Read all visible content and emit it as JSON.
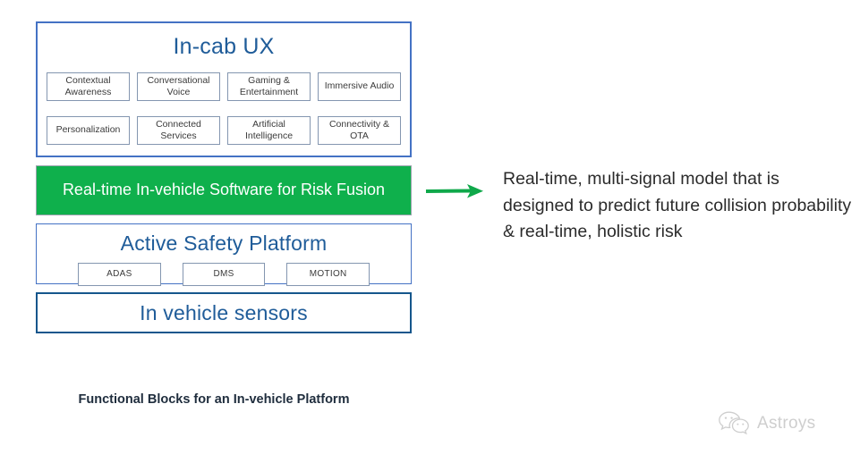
{
  "diagram": {
    "caption": "Functional Blocks for an In-vehicle Platform",
    "layers": [
      {
        "id": "in-cab-ux",
        "title": "In-cab UX",
        "border_color": "#4472c4",
        "rows": [
          [
            "Contextual Awareness",
            "Conversational Voice",
            "Gaming & Entertainment",
            "Immersive Audio"
          ],
          [
            "Personalization",
            "Connected Services",
            "Artificial Intelligence",
            "Connectivity & OTA"
          ]
        ]
      },
      {
        "id": "risk-fusion",
        "title": "Real-time In-vehicle Software for Risk Fusion",
        "fill_color": "#0fb04c",
        "text_color": "#ffffff"
      },
      {
        "id": "active-safety-platform",
        "title": "Active Safety Platform",
        "border_color": "#4472c4",
        "rows": [
          [
            "ADAS",
            "DMS",
            "MOTION"
          ]
        ]
      },
      {
        "id": "in-vehicle-sensors",
        "title": "In vehicle sensors",
        "border_color": "#15568c"
      }
    ]
  },
  "arrow": {
    "icon": "arrow-right-icon",
    "color": "#0fa84a",
    "direction": "right"
  },
  "description": {
    "text": "Real-time, multi-signal model that is designed to predict future collision probability & real-time, holistic risk"
  },
  "watermark": {
    "icon": "wechat-logo-icon",
    "label": "Astroys",
    "color": "#8c8c8c"
  },
  "colors": {
    "accent_blue": "#4472c4",
    "title_blue": "#1f5c99",
    "navy": "#15568c",
    "green": "#0fb04c",
    "chip_border": "#8496b0"
  }
}
